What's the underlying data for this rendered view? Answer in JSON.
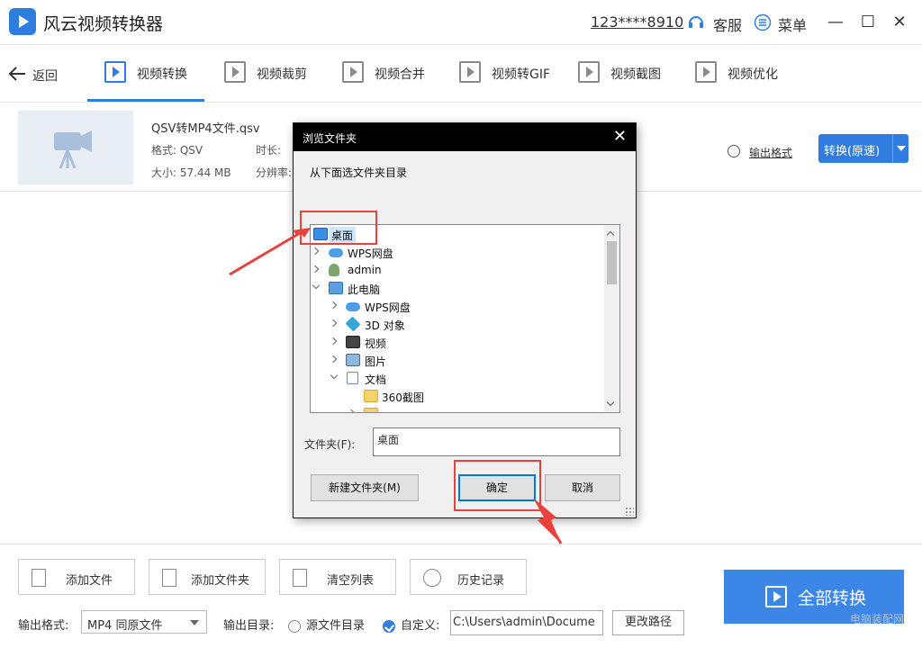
{
  "app": {
    "title": "风云视频转换器",
    "phone": "123****8910",
    "service_label": "客服",
    "menu_label": "菜单"
  },
  "nav": {
    "back_label": "返回",
    "tabs": [
      {
        "label": "视频转换",
        "icon": "video-convert-icon",
        "active": true
      },
      {
        "label": "视频裁剪",
        "icon": "video-crop-icon",
        "active": false
      },
      {
        "label": "视频合并",
        "icon": "video-merge-icon",
        "active": false
      },
      {
        "label": "视频转GIF",
        "icon": "gif-icon",
        "active": false
      },
      {
        "label": "视频截图",
        "icon": "screenshot-icon",
        "active": false
      },
      {
        "label": "视频优化",
        "icon": "optimize-icon",
        "active": false
      }
    ]
  },
  "file": {
    "name": "QSV转MP4文件.qsv",
    "format": "格式: QSV",
    "size": "大小: 57.44 MB",
    "duration_label": "时长:",
    "resolution_label": "分辨率:",
    "output_format_label": "输出格式",
    "convert_label": "转换(原速)"
  },
  "dialog": {
    "title": "浏览文件夹",
    "close": "✕",
    "instruction": "从下面选文件夹目录",
    "tree": [
      {
        "label": "桌面",
        "level": 0,
        "toggle": "none",
        "icon": "desktop-icon",
        "selected": true
      },
      {
        "label": "WPS网盘",
        "level": 0,
        "toggle": "closed",
        "icon": "cloud-icon",
        "selected": false
      },
      {
        "label": "admin",
        "level": 0,
        "toggle": "closed",
        "icon": "user-icon",
        "selected": false
      },
      {
        "label": "此电脑",
        "level": 0,
        "toggle": "open",
        "icon": "pc-icon",
        "selected": false
      },
      {
        "label": "WPS网盘",
        "level": 1,
        "toggle": "closed",
        "icon": "cloud-icon",
        "selected": false
      },
      {
        "label": "3D 对象",
        "level": 1,
        "toggle": "closed",
        "icon": "3d-objects-icon",
        "selected": false
      },
      {
        "label": "视频",
        "level": 1,
        "toggle": "closed",
        "icon": "video-folder-icon",
        "selected": false
      },
      {
        "label": "图片",
        "level": 1,
        "toggle": "closed",
        "icon": "pictures-icon",
        "selected": false
      },
      {
        "label": "文档",
        "level": 1,
        "toggle": "open",
        "icon": "documents-icon",
        "selected": false
      },
      {
        "label": "360截图",
        "level": 2,
        "toggle": "none",
        "icon": "folder-icon",
        "selected": false
      }
    ],
    "folder_label": "文件夹(F):",
    "folder_value": "桌面",
    "new_folder_label": "新建文件夹(M)",
    "ok_label": "确定",
    "cancel_label": "取消"
  },
  "bottom": {
    "add_file": "添加文件",
    "add_folder": "添加文件夹",
    "clear_list": "清空列表",
    "history": "历史记录",
    "all_convert": "全部转换",
    "output_format_label": "输出格式:",
    "output_format_value": "MP4 同原文件",
    "output_dir_label": "输出目录:",
    "source_dir_label": "源文件目录",
    "custom_label": "自定义:",
    "custom_checked": true,
    "path_value": "C:\\Users\\admin\\Docume",
    "change_path": "更改路径"
  },
  "watermark": "电脑装配网",
  "colors": {
    "accent": "#2f7de1",
    "annotation": "#e8413c",
    "dialog_title_bg": "#000000"
  }
}
